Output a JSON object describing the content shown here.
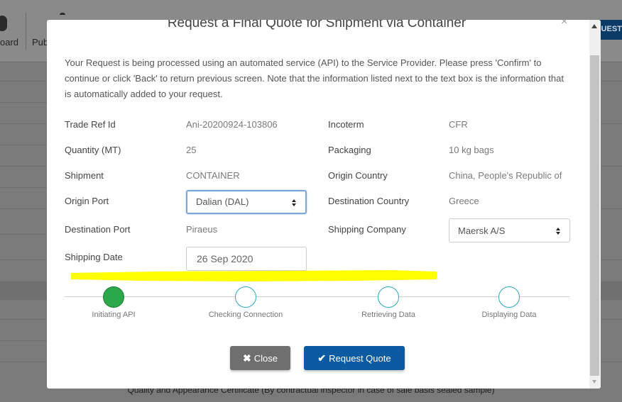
{
  "background": {
    "toolbar_items": [
      "oard",
      "Pub"
    ],
    "cta_label": "QUEST",
    "footer_text": "Quality and Appearance Certificate (By contractual inspector in case of sale basis sealed sample)"
  },
  "modal": {
    "title": "Request a Final Quote for Shipment via Container",
    "close_glyph": "×",
    "intro": "Your Request is being processed using an automated service (API) to the Service Provider. Please press 'Confirm' to continue or click 'Back' to return previous screen. Note that the information listed next to the text box is the information that is automatically added to your request.",
    "fields": {
      "trade_ref_label": "Trade Ref Id",
      "trade_ref_value": "Ani-20200924-103806",
      "incoterm_label": "Incoterm",
      "incoterm_value": "CFR",
      "quantity_label": "Quantity (MT)",
      "quantity_value": "25",
      "packaging_label": "Packaging",
      "packaging_value": "10 kg bags",
      "shipment_label": "Shipment",
      "shipment_value": "CONTAINER",
      "origin_country_label": "Origin Country",
      "origin_country_value": "China, People's Republic of",
      "origin_port_label": "Origin Port",
      "origin_port_value": "Dalian (DAL)",
      "destination_country_label": "Destination Country",
      "destination_country_value": "Greece",
      "destination_port_label": "Destination Port",
      "destination_port_value": "Piraeus",
      "shipping_company_label": "Shipping Company",
      "shipping_company_value": "Maersk A/S",
      "shipping_date_label": "Shipping Date",
      "shipping_date_value": "26 Sep 2020"
    },
    "steps": [
      {
        "label": "Initiating API",
        "state": "done"
      },
      {
        "label": "Checking Connection",
        "state": "pending"
      },
      {
        "label": "Retrieving Data",
        "state": "pending"
      },
      {
        "label": "Displaying Data",
        "state": "pending"
      }
    ],
    "buttons": {
      "close_label": "Close",
      "request_label": "Request Quote"
    }
  },
  "colors": {
    "highlight": "#ffff00",
    "step_done": "#2aa84a",
    "step_pending_border": "#2ea7c1",
    "primary": "#0b5aa2",
    "secondary": "#6f6f6f"
  },
  "icons": {
    "close_button_icon": "times-icon",
    "request_button_icon": "check-icon"
  }
}
